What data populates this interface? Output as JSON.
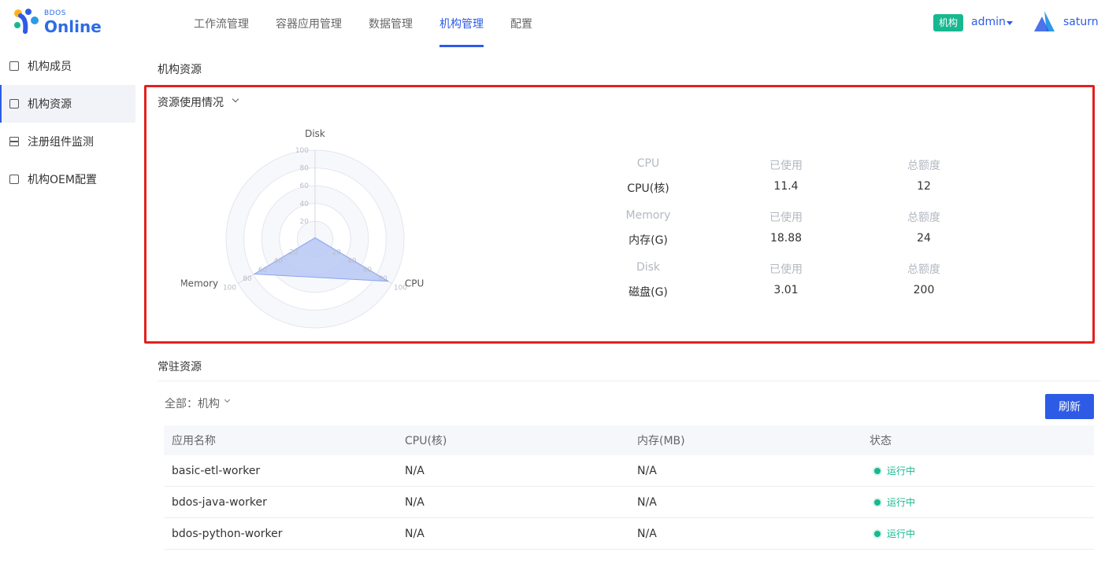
{
  "header": {
    "logo_small": "BDOS",
    "logo_big": "Online",
    "nav": [
      "工作流管理",
      "容器应用管理",
      "数据管理",
      "机构管理",
      "配置"
    ],
    "org_badge": "机构",
    "user": "admin",
    "tenant": "saturn"
  },
  "sidebar": {
    "items": [
      {
        "label": "机构成员"
      },
      {
        "label": "机构资源"
      },
      {
        "label": "注册组件监测"
      },
      {
        "label": "机构OEM配置"
      }
    ]
  },
  "main": {
    "title": "机构资源",
    "usage_title": "资源使用情况",
    "resident_title": "常驻资源"
  },
  "chart_data": {
    "type": "radar",
    "axes": [
      "Disk",
      "CPU",
      "Memory"
    ],
    "range": [
      0,
      100
    ],
    "ticks": [
      20,
      40,
      60,
      80,
      100
    ],
    "values": [
      1.5,
      95,
      78.7
    ],
    "fill_color": "#b7c8f5",
    "stroke_color": "#8aa4ee"
  },
  "stats": [
    {
      "type": "CPU",
      "used_label": "已使用",
      "total_label": "总额度",
      "name": "CPU(核)",
      "used": "11.4",
      "total": "12"
    },
    {
      "type": "Memory",
      "used_label": "已使用",
      "total_label": "总额度",
      "name": "内存(G)",
      "used": "18.88",
      "total": "24"
    },
    {
      "type": "Disk",
      "used_label": "已使用",
      "total_label": "总额度",
      "name": "磁盘(G)",
      "used": "3.01",
      "total": "200"
    }
  ],
  "filter": {
    "label": "全部：机构"
  },
  "refresh_label": "刷新",
  "table": {
    "headers": [
      "应用名称",
      "CPU(核)",
      "内存(MB)",
      "状态"
    ],
    "rows": [
      {
        "name": "basic-etl-worker",
        "cpu": "N/A",
        "mem": "N/A",
        "status": "运行中"
      },
      {
        "name": "bdos-java-worker",
        "cpu": "N/A",
        "mem": "N/A",
        "status": "运行中"
      },
      {
        "name": "bdos-python-worker",
        "cpu": "N/A",
        "mem": "N/A",
        "status": "运行中"
      }
    ]
  },
  "colors": {
    "accent": "#2e5be6",
    "success": "#17b890",
    "highlight": "#e32020"
  }
}
